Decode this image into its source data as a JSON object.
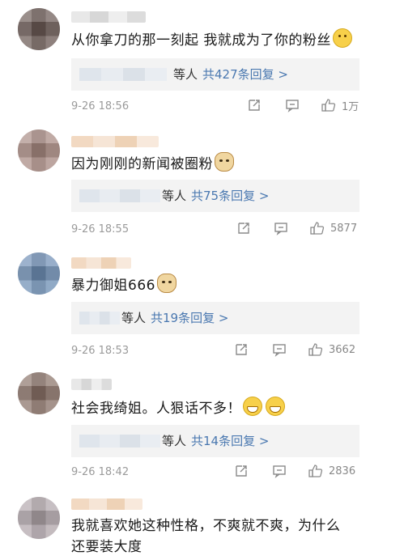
{
  "comments": [
    {
      "text": "从你拿刀的那一刻起 我就成为了你的粉丝",
      "emoji": "smile-emoji",
      "reply_who": "等人",
      "reply_count": "共427条回复 >",
      "time": "9-26 18:56",
      "likes": "1万"
    },
    {
      "text": "因为刚刚的新闻被圈粉",
      "emoji": "doge-emoji",
      "reply_who": "等人",
      "reply_count": "共75条回复 >",
      "time": "9-26 18:55",
      "likes": "5877"
    },
    {
      "text": "暴力御姐666",
      "emoji": "doge-emoji",
      "reply_who": "等人",
      "reply_count": "共19条回复 >",
      "time": "9-26 18:53",
      "likes": "3662"
    },
    {
      "text": "社会我绮姐。人狠话不多！",
      "emoji": "grin-emoji",
      "reply_who": "等人",
      "reply_count": "共14条回复 >",
      "time": "9-26 18:42",
      "likes": "2836"
    },
    {
      "text_line1": "我就喜欢她这种性格，不爽就不爽，为什么",
      "text_line2": "还要装大度"
    }
  ],
  "colors": {
    "reply_link": "#4a78b0",
    "reply_bg": "#f3f3f3",
    "meta_text": "#9a9a9a"
  },
  "icons": {
    "forward": "forward-icon",
    "comment": "comment-icon",
    "like": "thumbs-up-icon"
  }
}
